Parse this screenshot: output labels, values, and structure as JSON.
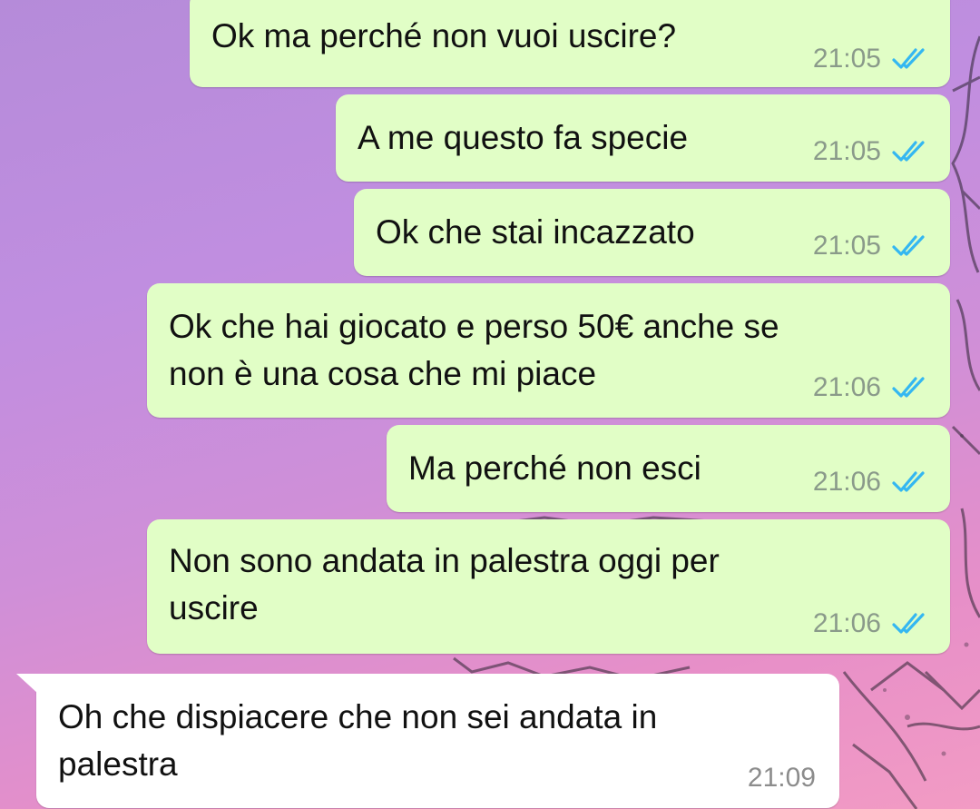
{
  "messages": [
    {
      "direction": "outgoing",
      "text": "Ok ma perché non vuoi uscire?",
      "time": "21:05",
      "status": "read"
    },
    {
      "direction": "outgoing",
      "text": "A me questo fa specie",
      "time": "21:05",
      "status": "read"
    },
    {
      "direction": "outgoing",
      "text": "Ok che stai incazzato",
      "time": "21:05",
      "status": "read"
    },
    {
      "direction": "outgoing",
      "text": "Ok che hai giocato e perso 50€ anche se\nnon è una cosa che mi piace",
      "time": "21:06",
      "status": "read"
    },
    {
      "direction": "outgoing",
      "text": "Ma perché non esci",
      "time": "21:06",
      "status": "read"
    },
    {
      "direction": "outgoing",
      "text": "Non sono andata in palestra oggi per\nuscire",
      "time": "21:06",
      "status": "read"
    },
    {
      "direction": "incoming",
      "text": "Oh che dispiacere che non sei andata in\npalestra",
      "time": "21:09"
    }
  ],
  "colors": {
    "outgoing_bubble": "#e1fec6",
    "incoming_bubble": "#ffffff",
    "read_ticks": "#34b7f1"
  },
  "icons": {
    "read_receipt": "double-check-icon"
  }
}
